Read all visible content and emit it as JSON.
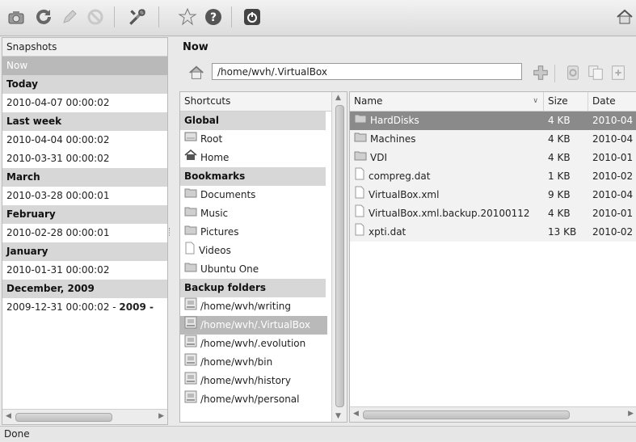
{
  "toolbar": {
    "icons": [
      "snapshot-icon",
      "refresh-icon",
      "edit-icon",
      "stop-icon",
      "tools-icon",
      "star-icon",
      "help-icon",
      "power-icon",
      "home-icon"
    ]
  },
  "snapshots": {
    "header": "Snapshots",
    "rows": [
      {
        "text": "Now",
        "kind": "selected"
      },
      {
        "text": "Today",
        "kind": "group"
      },
      {
        "text": "2010-04-07 00:00:02",
        "kind": "item"
      },
      {
        "text": "Last week",
        "kind": "group"
      },
      {
        "text": "2010-04-04 00:00:02",
        "kind": "item"
      },
      {
        "text": "2010-03-31 00:00:02",
        "kind": "item"
      },
      {
        "text": "March",
        "kind": "group"
      },
      {
        "text": "2010-03-28 00:00:01",
        "kind": "item"
      },
      {
        "text": "February",
        "kind": "group"
      },
      {
        "text": "2010-02-28 00:00:01",
        "kind": "item"
      },
      {
        "text": "January",
        "kind": "group"
      },
      {
        "text": "2010-01-31 00:00:02",
        "kind": "item"
      },
      {
        "text": "December, 2009",
        "kind": "group"
      }
    ],
    "last_row_plain": "2009-12-31 00:00:02 - ",
    "last_row_bold": "2009 -"
  },
  "main": {
    "title": "Now",
    "location": "/home/wvh/.VirtualBox"
  },
  "shortcuts": {
    "header": "Shortcuts",
    "rows": [
      {
        "text": "Global",
        "kind": "group"
      },
      {
        "text": "Root",
        "kind": "item",
        "icon": "drive-icon"
      },
      {
        "text": "Home",
        "kind": "item",
        "icon": "home-icon"
      },
      {
        "text": "Bookmarks",
        "kind": "group"
      },
      {
        "text": "Documents",
        "kind": "item",
        "icon": "folder-icon"
      },
      {
        "text": "Music",
        "kind": "item",
        "icon": "folder-icon"
      },
      {
        "text": "Pictures",
        "kind": "item",
        "icon": "folder-icon"
      },
      {
        "text": "Videos",
        "kind": "item",
        "icon": "file-icon"
      },
      {
        "text": "Ubuntu One",
        "kind": "item",
        "icon": "folder-icon"
      },
      {
        "text": "Backup folders",
        "kind": "group"
      },
      {
        "text": "/home/wvh/writing",
        "kind": "item",
        "icon": "backup-folder-icon"
      },
      {
        "text": "/home/wvh/.VirtualBox",
        "kind": "selected",
        "icon": "backup-folder-icon"
      },
      {
        "text": "/home/wvh/.evolution",
        "kind": "item",
        "icon": "backup-folder-icon"
      },
      {
        "text": "/home/wvh/bin",
        "kind": "item",
        "icon": "backup-folder-icon"
      },
      {
        "text": "/home/wvh/history",
        "kind": "item",
        "icon": "backup-folder-icon"
      },
      {
        "text": "/home/wvh/personal",
        "kind": "item",
        "icon": "backup-folder-icon"
      }
    ]
  },
  "files": {
    "columns": {
      "name": "Name",
      "size": "Size",
      "date": "Date"
    },
    "rows": [
      {
        "name": "HardDisks",
        "size": "4 KB",
        "date": "2010-04",
        "icon": "folder-icon",
        "selected": true
      },
      {
        "name": "Machines",
        "size": "4 KB",
        "date": "2010-04",
        "icon": "folder-icon"
      },
      {
        "name": "VDI",
        "size": "4 KB",
        "date": "2010-01",
        "icon": "folder-icon"
      },
      {
        "name": "compreg.dat",
        "size": "1 KB",
        "date": "2010-02",
        "icon": "file-icon"
      },
      {
        "name": "VirtualBox.xml",
        "size": "9 KB",
        "date": "2010-04",
        "icon": "file-icon"
      },
      {
        "name": "VirtualBox.xml.backup.20100112",
        "size": "4 KB",
        "date": "2010-01",
        "icon": "file-icon"
      },
      {
        "name": "xpti.dat",
        "size": "13 KB",
        "date": "2010-02",
        "icon": "file-icon"
      }
    ]
  },
  "status": {
    "text": "Done"
  }
}
